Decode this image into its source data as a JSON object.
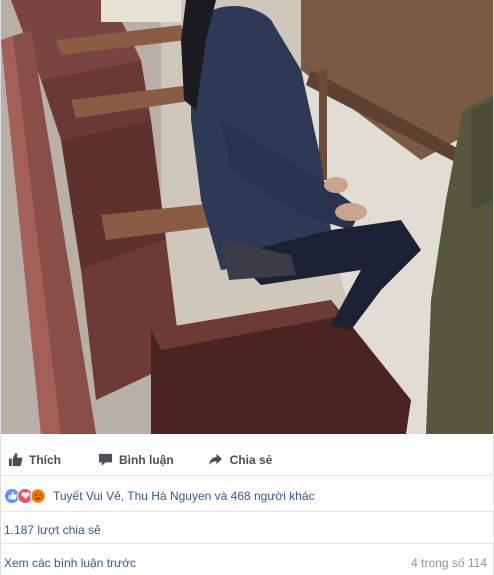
{
  "post": {
    "photo_description_icon": "photo",
    "actions": {
      "like_label": "Thích",
      "comment_label": "Bình luận",
      "share_label": "Chia sẻ"
    },
    "reactions": {
      "icons": [
        "like-reaction-icon",
        "love-reaction-icon",
        "angry-reaction-icon"
      ],
      "summary": "Tuyết Vui Vẻ, Thu Hà Nguyen và 468 người khác"
    },
    "shares_text": "1.187 lượt chia sẻ",
    "comments": {
      "view_previous": "Xem các bình luận trước",
      "count": "4 trong số 114"
    }
  },
  "colors": {
    "link": "#365899",
    "like_blue": "#5890ff",
    "love_red": "#f25268",
    "angry_yellow": "#f7b125",
    "muted": "#90949c"
  }
}
